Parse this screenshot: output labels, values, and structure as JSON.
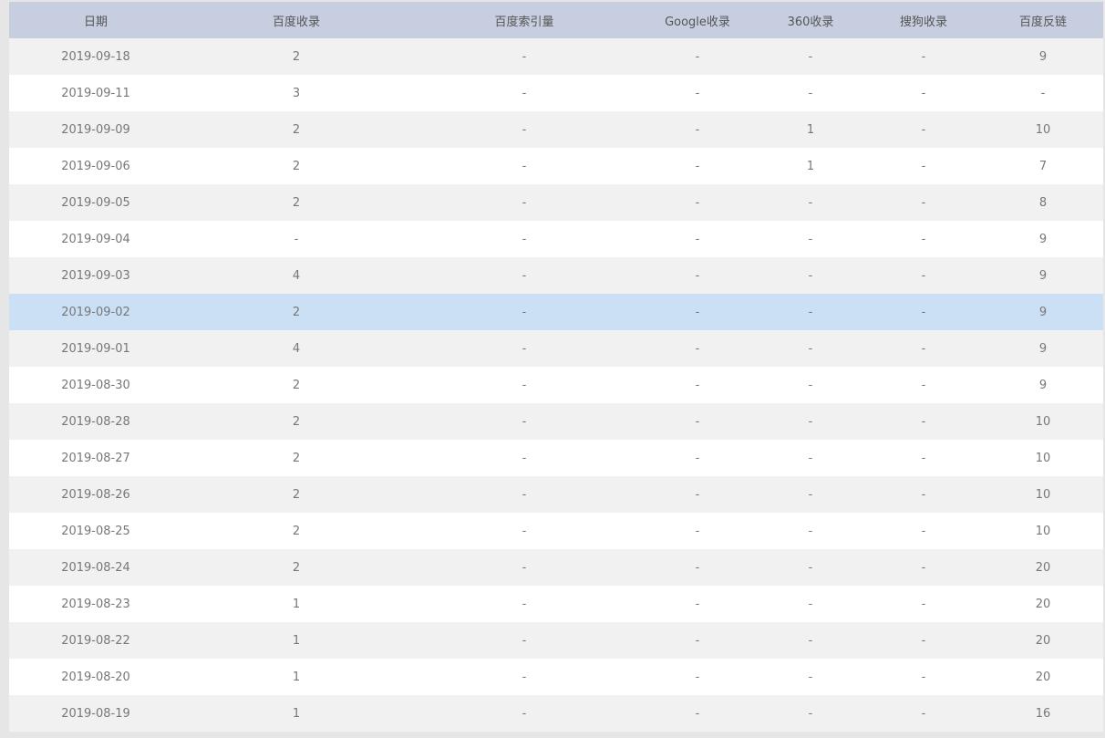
{
  "columns": [
    "日期",
    "百度收录",
    "百度索引量",
    "Google收录",
    "360收录",
    "搜狗收录",
    "百度反链"
  ],
  "highlight_row": 7,
  "colors": {
    "header_bg": "#c6cedf",
    "row_odd": "#f1f1f1",
    "row_even": "#ffffff",
    "row_highlight": "#cce0f5"
  },
  "rows": [
    [
      "2019-09-18",
      "2",
      "-",
      "-",
      "-",
      "-",
      "9"
    ],
    [
      "2019-09-11",
      "3",
      "-",
      "-",
      "-",
      "-",
      "-"
    ],
    [
      "2019-09-09",
      "2",
      "-",
      "-",
      "1",
      "-",
      "10"
    ],
    [
      "2019-09-06",
      "2",
      "-",
      "-",
      "1",
      "-",
      "7"
    ],
    [
      "2019-09-05",
      "2",
      "-",
      "-",
      "-",
      "-",
      "8"
    ],
    [
      "2019-09-04",
      "-",
      "-",
      "-",
      "-",
      "-",
      "9"
    ],
    [
      "2019-09-03",
      "4",
      "-",
      "-",
      "-",
      "-",
      "9"
    ],
    [
      "2019-09-02",
      "2",
      "-",
      "-",
      "-",
      "-",
      "9"
    ],
    [
      "2019-09-01",
      "4",
      "-",
      "-",
      "-",
      "-",
      "9"
    ],
    [
      "2019-08-30",
      "2",
      "-",
      "-",
      "-",
      "-",
      "9"
    ],
    [
      "2019-08-28",
      "2",
      "-",
      "-",
      "-",
      "-",
      "10"
    ],
    [
      "2019-08-27",
      "2",
      "-",
      "-",
      "-",
      "-",
      "10"
    ],
    [
      "2019-08-26",
      "2",
      "-",
      "-",
      "-",
      "-",
      "10"
    ],
    [
      "2019-08-25",
      "2",
      "-",
      "-",
      "-",
      "-",
      "10"
    ],
    [
      "2019-08-24",
      "2",
      "-",
      "-",
      "-",
      "-",
      "20"
    ],
    [
      "2019-08-23",
      "1",
      "-",
      "-",
      "-",
      "-",
      "20"
    ],
    [
      "2019-08-22",
      "1",
      "-",
      "-",
      "-",
      "-",
      "20"
    ],
    [
      "2019-08-20",
      "1",
      "-",
      "-",
      "-",
      "-",
      "20"
    ],
    [
      "2019-08-19",
      "1",
      "-",
      "-",
      "-",
      "-",
      "16"
    ]
  ]
}
